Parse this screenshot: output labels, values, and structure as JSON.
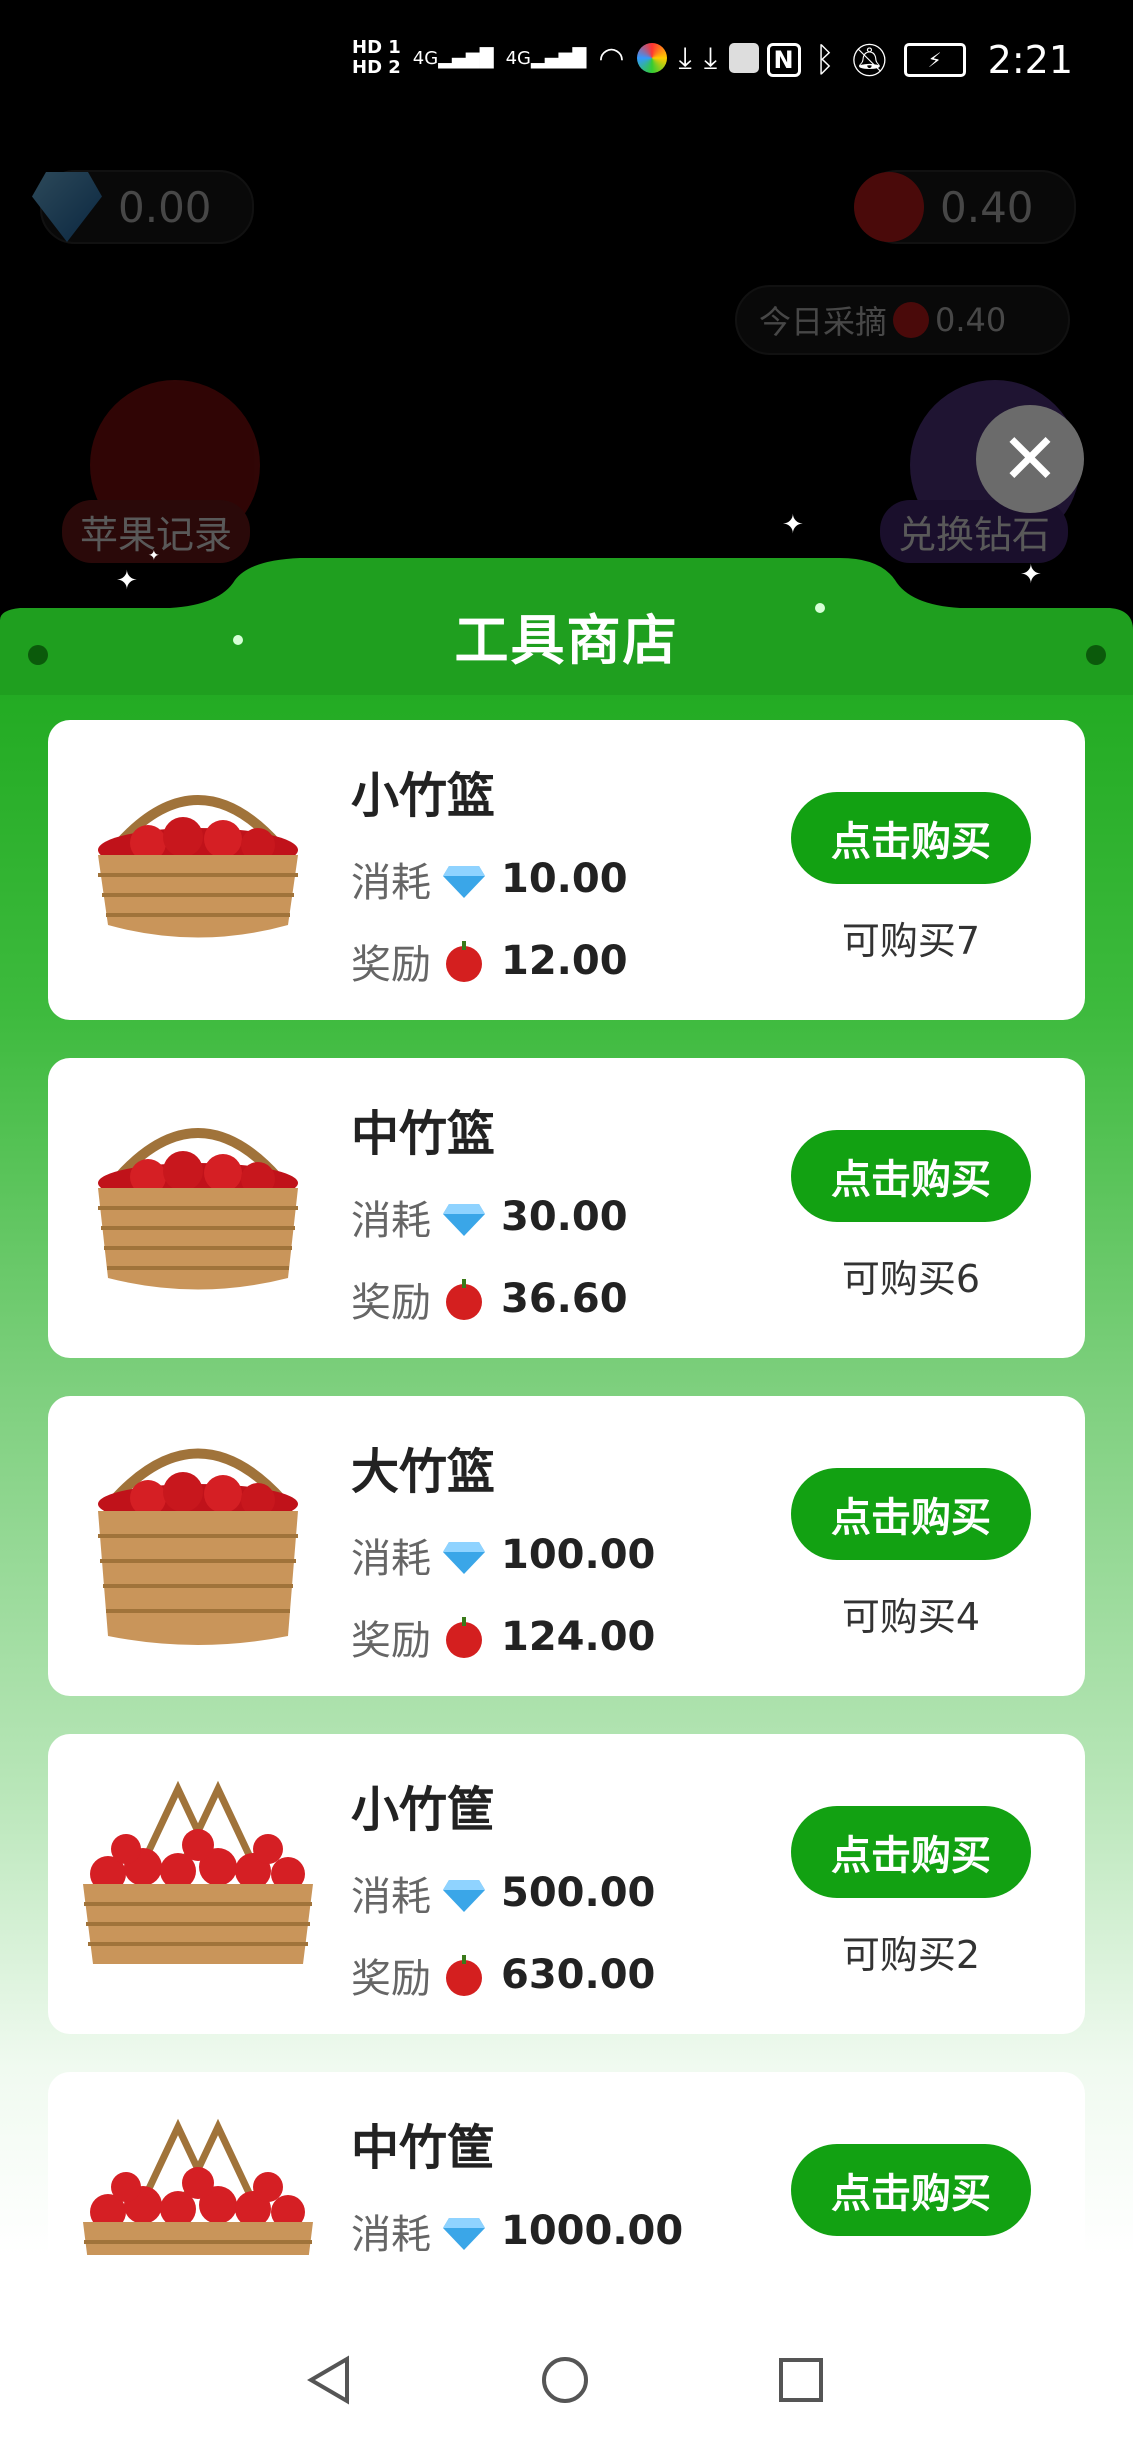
{
  "status_bar": {
    "time": "2:21",
    "hd1": "HD 1",
    "hd2": "HD 2",
    "net1": "4G",
    "net2": "4G",
    "icons": [
      "signal-icon",
      "wifi-icon",
      "app-icon",
      "download-icon",
      "download-icon",
      "huawei-icon",
      "nfc-icon",
      "bluetooth-icon",
      "mute-icon",
      "battery-icon"
    ]
  },
  "background": {
    "diamond_balance": "0.00",
    "apple_balance": "0.40",
    "today_label": "今日采摘",
    "today_value": "0.40",
    "apple_record_label": "苹果记录",
    "exchange_label": "兑换钻石"
  },
  "shop": {
    "title": "工具商店",
    "cost_label": "消耗",
    "reward_label": "奖励",
    "buy_label": "点击购买",
    "items": [
      {
        "name": "小竹篮",
        "cost": "10.00",
        "reward": "12.00",
        "available": "可购买7"
      },
      {
        "name": "中竹篮",
        "cost": "30.00",
        "reward": "36.60",
        "available": "可购买6"
      },
      {
        "name": "大竹篮",
        "cost": "100.00",
        "reward": "124.00",
        "available": "可购买4"
      },
      {
        "name": "小竹筐",
        "cost": "500.00",
        "reward": "630.00",
        "available": "可购买2"
      },
      {
        "name": "中竹筐",
        "cost": "1000.00",
        "reward": "",
        "available": ""
      }
    ]
  },
  "colors": {
    "accent_green": "#12a112",
    "panel_green": "#23ab23",
    "diamond_blue": "#3aa6e8",
    "apple_red": "#d41f1f"
  }
}
